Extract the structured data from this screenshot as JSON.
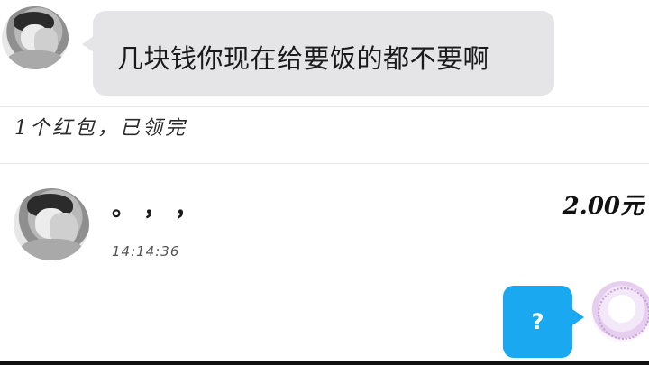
{
  "messages": {
    "incoming_text": "几块钱你现在给要饭的都不要啊",
    "red_packet_notice": "1个红包，已领完",
    "red_packet_entry": {
      "text": "。，，",
      "time": "14:14:36",
      "amount": "2.00元"
    },
    "outgoing_text": "?"
  },
  "avatars": {
    "top": "user-avatar",
    "middle": "user-avatar",
    "right": "self-avatar"
  },
  "colors": {
    "incoming_bubble": "#e5e5e7",
    "outgoing_bubble": "#1aa8f0"
  }
}
